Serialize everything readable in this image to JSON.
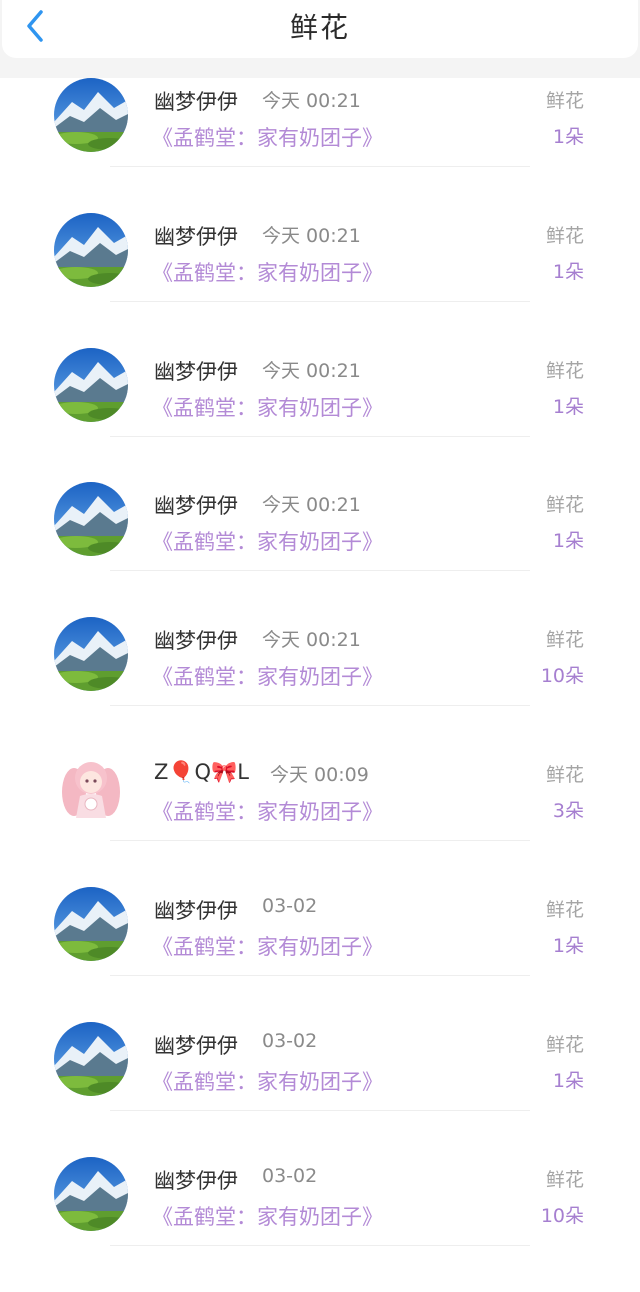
{
  "header": {
    "title": "鲜花",
    "back_icon": "chevron-left-icon",
    "accent": "#2f95f0"
  },
  "colors": {
    "book": "#b38ad6",
    "count": "#a67fd0",
    "muted": "#a5a5a5"
  },
  "rows": [
    {
      "name": "幽梦伊伊",
      "time": "今天 00:21",
      "book": "《孟鹤堂：家有奶团子》",
      "gift_type": "鲜花",
      "gift_count": "1朵",
      "avatar": "mountain-landscape-avatar"
    },
    {
      "name": "幽梦伊伊",
      "time": "今天 00:21",
      "book": "《孟鹤堂：家有奶团子》",
      "gift_type": "鲜花",
      "gift_count": "1朵",
      "avatar": "mountain-landscape-avatar"
    },
    {
      "name": "幽梦伊伊",
      "time": "今天 00:21",
      "book": "《孟鹤堂：家有奶团子》",
      "gift_type": "鲜花",
      "gift_count": "1朵",
      "avatar": "mountain-landscape-avatar"
    },
    {
      "name": "幽梦伊伊",
      "time": "今天 00:21",
      "book": "《孟鹤堂：家有奶团子》",
      "gift_type": "鲜花",
      "gift_count": "1朵",
      "avatar": "mountain-landscape-avatar"
    },
    {
      "name": "幽梦伊伊",
      "time": "今天 00:21",
      "book": "《孟鹤堂：家有奶团子》",
      "gift_type": "鲜花",
      "gift_count": "10朵",
      "avatar": "mountain-landscape-avatar"
    },
    {
      "name": "Z🎈Q🎀L",
      "time": "今天 00:09",
      "book": "《孟鹤堂：家有奶团子》",
      "gift_type": "鲜花",
      "gift_count": "3朵",
      "avatar": "anime-girl-avatar"
    },
    {
      "name": "幽梦伊伊",
      "time": "03-02",
      "book": "《孟鹤堂：家有奶团子》",
      "gift_type": "鲜花",
      "gift_count": "1朵",
      "avatar": "mountain-landscape-avatar"
    },
    {
      "name": "幽梦伊伊",
      "time": "03-02",
      "book": "《孟鹤堂：家有奶团子》",
      "gift_type": "鲜花",
      "gift_count": "1朵",
      "avatar": "mountain-landscape-avatar"
    },
    {
      "name": "幽梦伊伊",
      "time": "03-02",
      "book": "《孟鹤堂：家有奶团子》",
      "gift_type": "鲜花",
      "gift_count": "10朵",
      "avatar": "mountain-landscape-avatar"
    }
  ]
}
